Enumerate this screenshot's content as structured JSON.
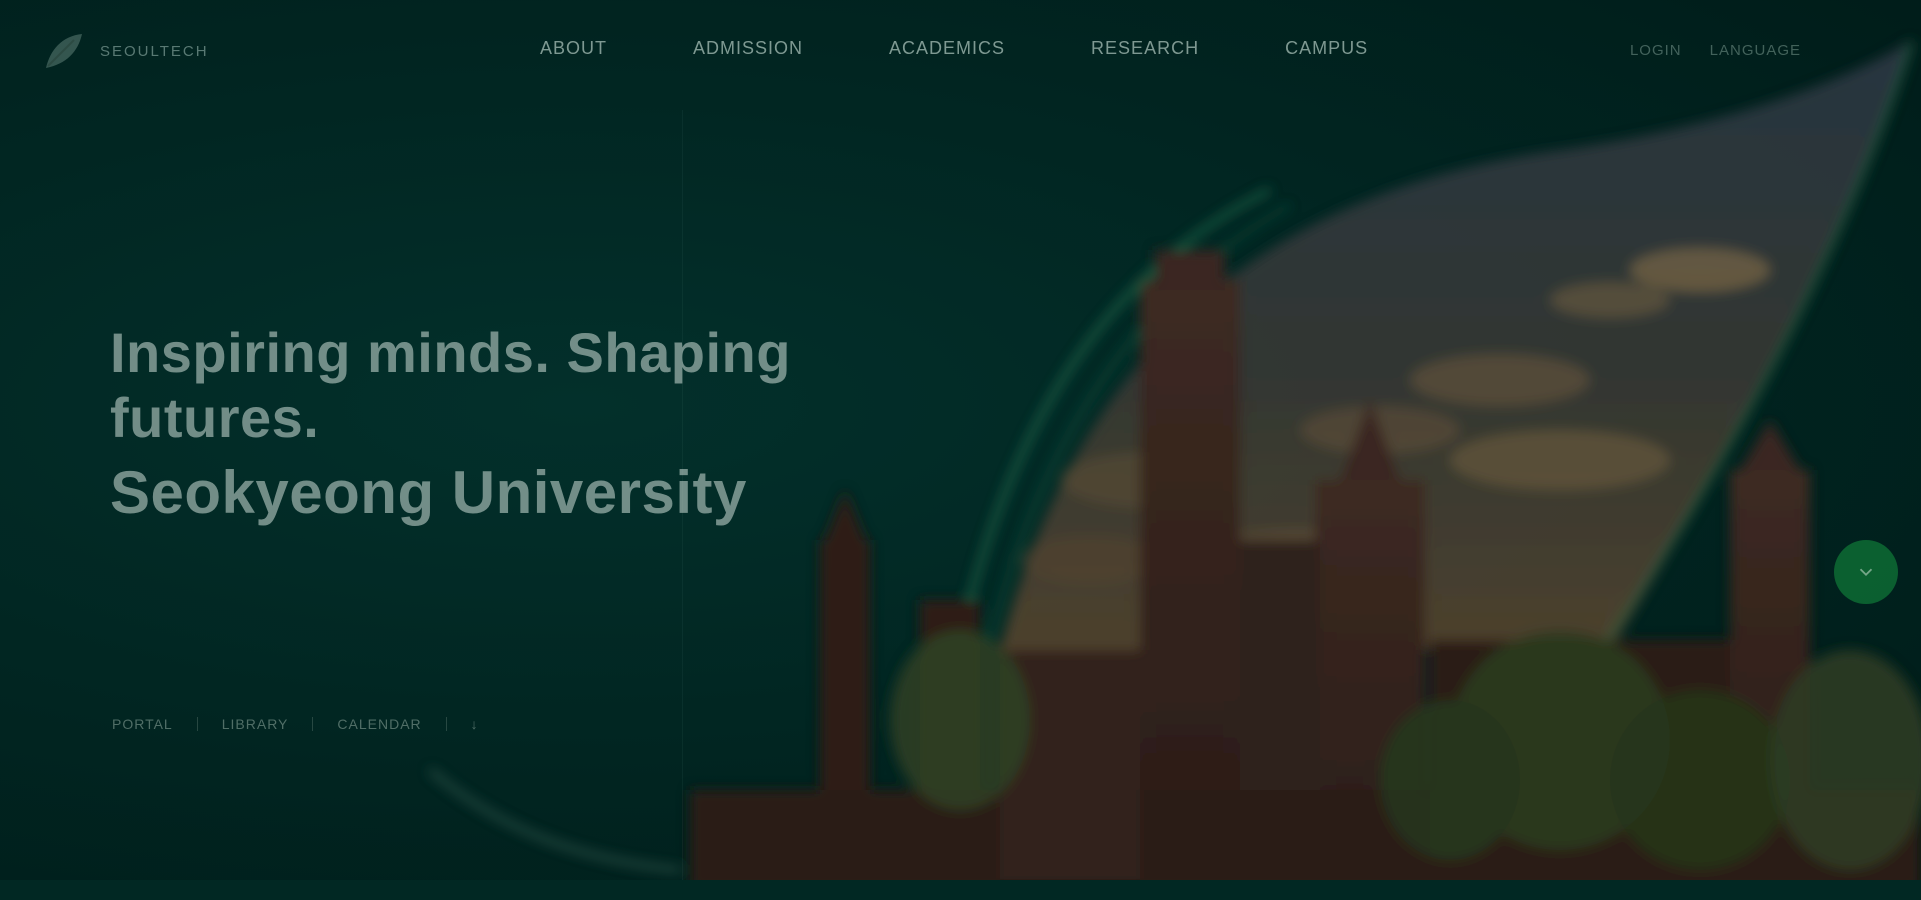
{
  "header": {
    "logo_text": "SEOULTECH",
    "nav": [
      "ABOUT",
      "ADMISSION",
      "ACADEMICS",
      "RESEARCH",
      "CAMPUS"
    ],
    "right_links": [
      "LOGIN",
      "LANGUAGE"
    ]
  },
  "hero": {
    "tagline": "Inspiring minds. Shaping futures.",
    "university": "Seokyeong University",
    "quick_links": [
      "PORTAL",
      "LIBRARY",
      "CALENDAR",
      "↓"
    ]
  },
  "colors": {
    "background": "#012622",
    "accent": "#0e6b34",
    "curve": "#2f8b5e"
  },
  "icons": {
    "logo": "leaf-logo-icon",
    "scroll": "chevron-down-icon"
  }
}
